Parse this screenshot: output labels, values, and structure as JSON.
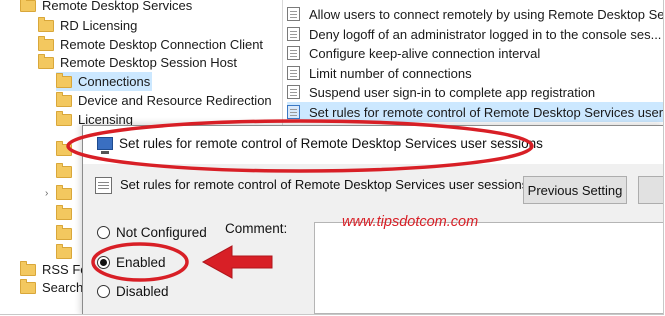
{
  "tree": {
    "items": [
      {
        "label": "Remote Desktop Services"
      },
      {
        "label": "RD Licensing"
      },
      {
        "label": "Remote Desktop Connection Client"
      },
      {
        "label": "Remote Desktop Session Host"
      },
      {
        "label": "Connections"
      },
      {
        "label": "Device and Resource Redirection"
      },
      {
        "label": "Licensing"
      },
      {
        "label": "RSS Feed"
      },
      {
        "label": "Search"
      }
    ]
  },
  "policies": {
    "items": [
      {
        "label": "Allow users to connect remotely by using Remote Desktop Se..."
      },
      {
        "label": "Deny logoff of an administrator logged in to the console ses..."
      },
      {
        "label": "Configure keep-alive connection interval"
      },
      {
        "label": "Limit number of connections"
      },
      {
        "label": "Suspend user sign-in to complete app registration"
      },
      {
        "label": "Set rules for remote control of Remote Desktop Services user ..."
      }
    ]
  },
  "dialog": {
    "title": "Set rules for remote control of Remote Desktop Services user sessions",
    "header": "Set rules for remote control of Remote Desktop Services user sessions",
    "previous_button": "Previous Setting",
    "comment_label": "Comment:",
    "options": {
      "not_configured": "Not Configured",
      "enabled": "Enabled",
      "disabled": "Disabled"
    },
    "selected_option": "Enabled"
  },
  "watermark": "www.tipsdotcom.com",
  "colors": {
    "annotation_red": "#d81f26",
    "selection": "#cce8ff"
  }
}
